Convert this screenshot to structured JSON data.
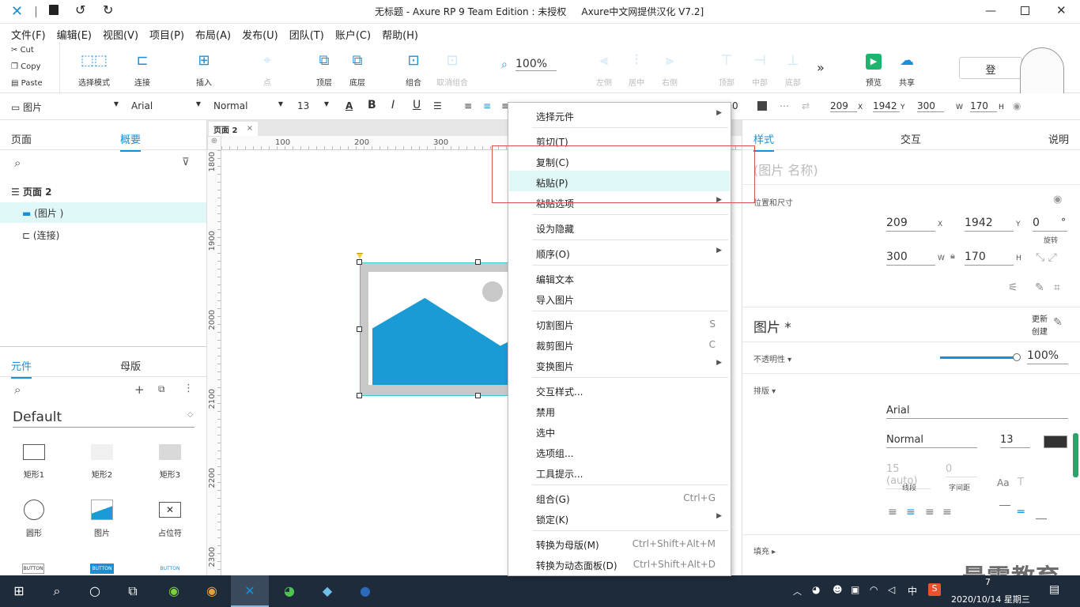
{
  "titlebar": {
    "title": "无标题 - Axure RP 9 Team Edition : 未授权     Axure中文网提供汉化 V7.2]"
  },
  "menubar": [
    "文件(F)",
    "编辑(E)",
    "视图(V)",
    "项目(P)",
    "布局(A)",
    "发布(U)",
    "团队(T)",
    "账户(C)",
    "帮助(H)"
  ],
  "clipboard": {
    "cut": "Cut",
    "copy": "Copy",
    "paste": "Paste"
  },
  "toolbar": {
    "select_mode": "选择模式",
    "connect": "连接",
    "insert": "插入",
    "point": "点",
    "top": "顶层",
    "bottom": "底层",
    "group": "组合",
    "ungroup": "取消组合",
    "zoom": "100%",
    "align_left": "左侧",
    "align_center": "居中",
    "align_right": "右侧",
    "align_top": "顶部",
    "align_middle": "中部",
    "align_bottom": "底部",
    "preview": "预览",
    "share": "共享",
    "login": "登"
  },
  "formatbar": {
    "widget_type": "图片",
    "font": "Arial",
    "weight": "Normal",
    "size": "13",
    "x": "209",
    "x_label": "X",
    "y": "1942",
    "y_label": "Y",
    "w": "300",
    "w_label": "W",
    "h": "170",
    "h_label": "H",
    "border": "0"
  },
  "leftpanel": {
    "tab_pages": "页面",
    "tab_outline": "概要",
    "outline": {
      "page": "页面 2",
      "items": [
        "(图片 )",
        "(连接)"
      ]
    },
    "tab_widgets": "元件",
    "tab_masters": "母版",
    "library": "Default",
    "widgets": [
      {
        "label": "矩形1"
      },
      {
        "label": "矩形2"
      },
      {
        "label": "矩形3"
      },
      {
        "label": "圆形"
      },
      {
        "label": "图片"
      },
      {
        "label": "占位符"
      }
    ],
    "button_labels": [
      "BUTTON",
      "BUTTON",
      "BUTTON"
    ]
  },
  "canvas": {
    "tab": "页面 2",
    "ruler_h": [
      "100",
      "200",
      "300"
    ],
    "ruler_v": [
      "1800",
      "1900",
      "2000",
      "2100",
      "2200",
      "2300"
    ]
  },
  "context_menu": [
    {
      "label": "选择元件",
      "arrow": true
    },
    {
      "sep": true
    },
    {
      "label": "剪切(T)"
    },
    {
      "label": "复制(C)"
    },
    {
      "label": "粘贴(P)",
      "highlight": true
    },
    {
      "label": "粘贴选项",
      "arrow": true
    },
    {
      "sep": true
    },
    {
      "label": "设为隐藏"
    },
    {
      "sep": true
    },
    {
      "label": "顺序(O)",
      "arrow": true
    },
    {
      "sep": true
    },
    {
      "label": "编辑文本"
    },
    {
      "label": "导入图片"
    },
    {
      "sep": true
    },
    {
      "label": "切割图片",
      "shortcut": "S"
    },
    {
      "label": "裁剪图片",
      "shortcut": "C"
    },
    {
      "label": "变换图片",
      "arrow": true
    },
    {
      "sep": true
    },
    {
      "label": "交互样式..."
    },
    {
      "label": "禁用"
    },
    {
      "label": "选中"
    },
    {
      "label": "选项组..."
    },
    {
      "label": "工具提示..."
    },
    {
      "sep": true
    },
    {
      "label": "组合(G)",
      "shortcut": "Ctrl+G"
    },
    {
      "label": "锁定(K)",
      "arrow": true
    },
    {
      "sep": true
    },
    {
      "label": "转换为母版(M)",
      "shortcut": "Ctrl+Shift+Alt+M"
    },
    {
      "label": "转换为动态面板(D)",
      "shortcut": "Ctrl+Shift+Alt+D"
    }
  ],
  "rightpanel": {
    "tab_style": "样式",
    "tab_interact": "交互",
    "tab_notes": "说明",
    "name_placeholder": "(图片 名称)",
    "pos_size": "位置和尺寸",
    "x": "209",
    "x_label": "X",
    "y": "1942",
    "y_label": "Y",
    "rotate": "0",
    "rotate_unit": "°",
    "rotate_label": "旋转",
    "w": "300",
    "w_label": "W",
    "h": "170",
    "h_label": "H",
    "style_name": "图片 *",
    "update": "更新",
    "create": "创建",
    "opacity_label": "不透明性",
    "opacity": "100%",
    "opacity_value": 1.0,
    "typeset": "排版",
    "font": "Arial",
    "weight": "Normal",
    "size": "13",
    "line_spacing": "15 (auto)",
    "line_spacing_label": "线段",
    "char_spacing": "0",
    "char_spacing_label": "字间距",
    "fill": "填充"
  },
  "watermark": "最需教育",
  "taskbar": {
    "time": "7",
    "date": "2020/10/14 星期三",
    "ime": "中"
  },
  "colors": {
    "accent": "#1a8fd6",
    "highlight": "#e0f7f7",
    "image_blue": "#1a9bd6",
    "red_box": "#d9534f"
  }
}
